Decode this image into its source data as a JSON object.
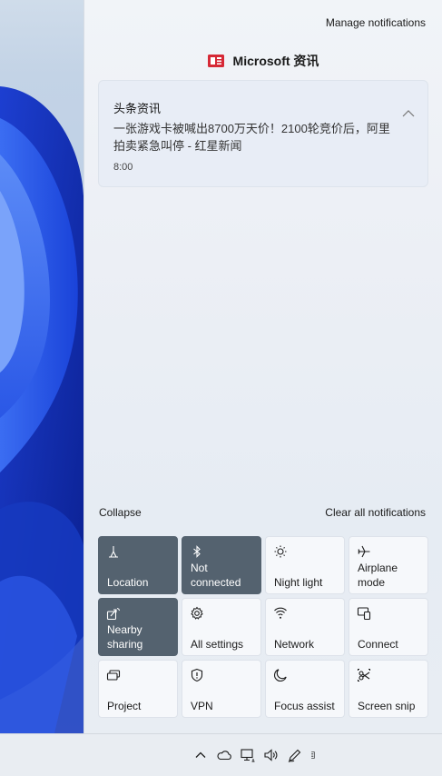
{
  "panel": {
    "manage_label": "Manage notifications",
    "app_name": "Microsoft 资讯",
    "collapse_label": "Collapse",
    "clear_all_label": "Clear all notifications"
  },
  "notification": {
    "title": "头条资讯",
    "body": "一张游戏卡被喊出8700万天价！2100轮竞价后，阿里拍卖紧急叫停 - 红星新闻",
    "time": "8:00"
  },
  "quick_actions": [
    {
      "label": "Location",
      "icon": "location-icon",
      "on": true
    },
    {
      "label": "Not connected",
      "icon": "bluetooth-icon",
      "on": true
    },
    {
      "label": "Night light",
      "icon": "night-light-icon",
      "on": false
    },
    {
      "label": "Airplane mode",
      "icon": "airplane-icon",
      "on": false
    },
    {
      "label": "Nearby sharing",
      "icon": "nearby-sharing-icon",
      "on": true
    },
    {
      "label": "All settings",
      "icon": "gear-icon",
      "on": false
    },
    {
      "label": "Network",
      "icon": "network-icon",
      "on": false
    },
    {
      "label": "Connect",
      "icon": "connect-icon",
      "on": false
    },
    {
      "label": "Project",
      "icon": "project-icon",
      "on": false
    },
    {
      "label": "VPN",
      "icon": "vpn-shield-icon",
      "on": false
    },
    {
      "label": "Focus assist",
      "icon": "moon-icon",
      "on": false
    },
    {
      "label": "Screen snip",
      "icon": "scissors-icon",
      "on": false
    }
  ],
  "taskbar": {
    "tray_icons": [
      "chevron-up-icon",
      "onedrive-cloud-icon",
      "network-monitor-icon",
      "speaker-icon",
      "pen-icon",
      "input-icon"
    ]
  },
  "colors": {
    "tile_active": "#54626f",
    "tile_inactive": "#f6f8fb",
    "app_brand": "#d62936"
  }
}
